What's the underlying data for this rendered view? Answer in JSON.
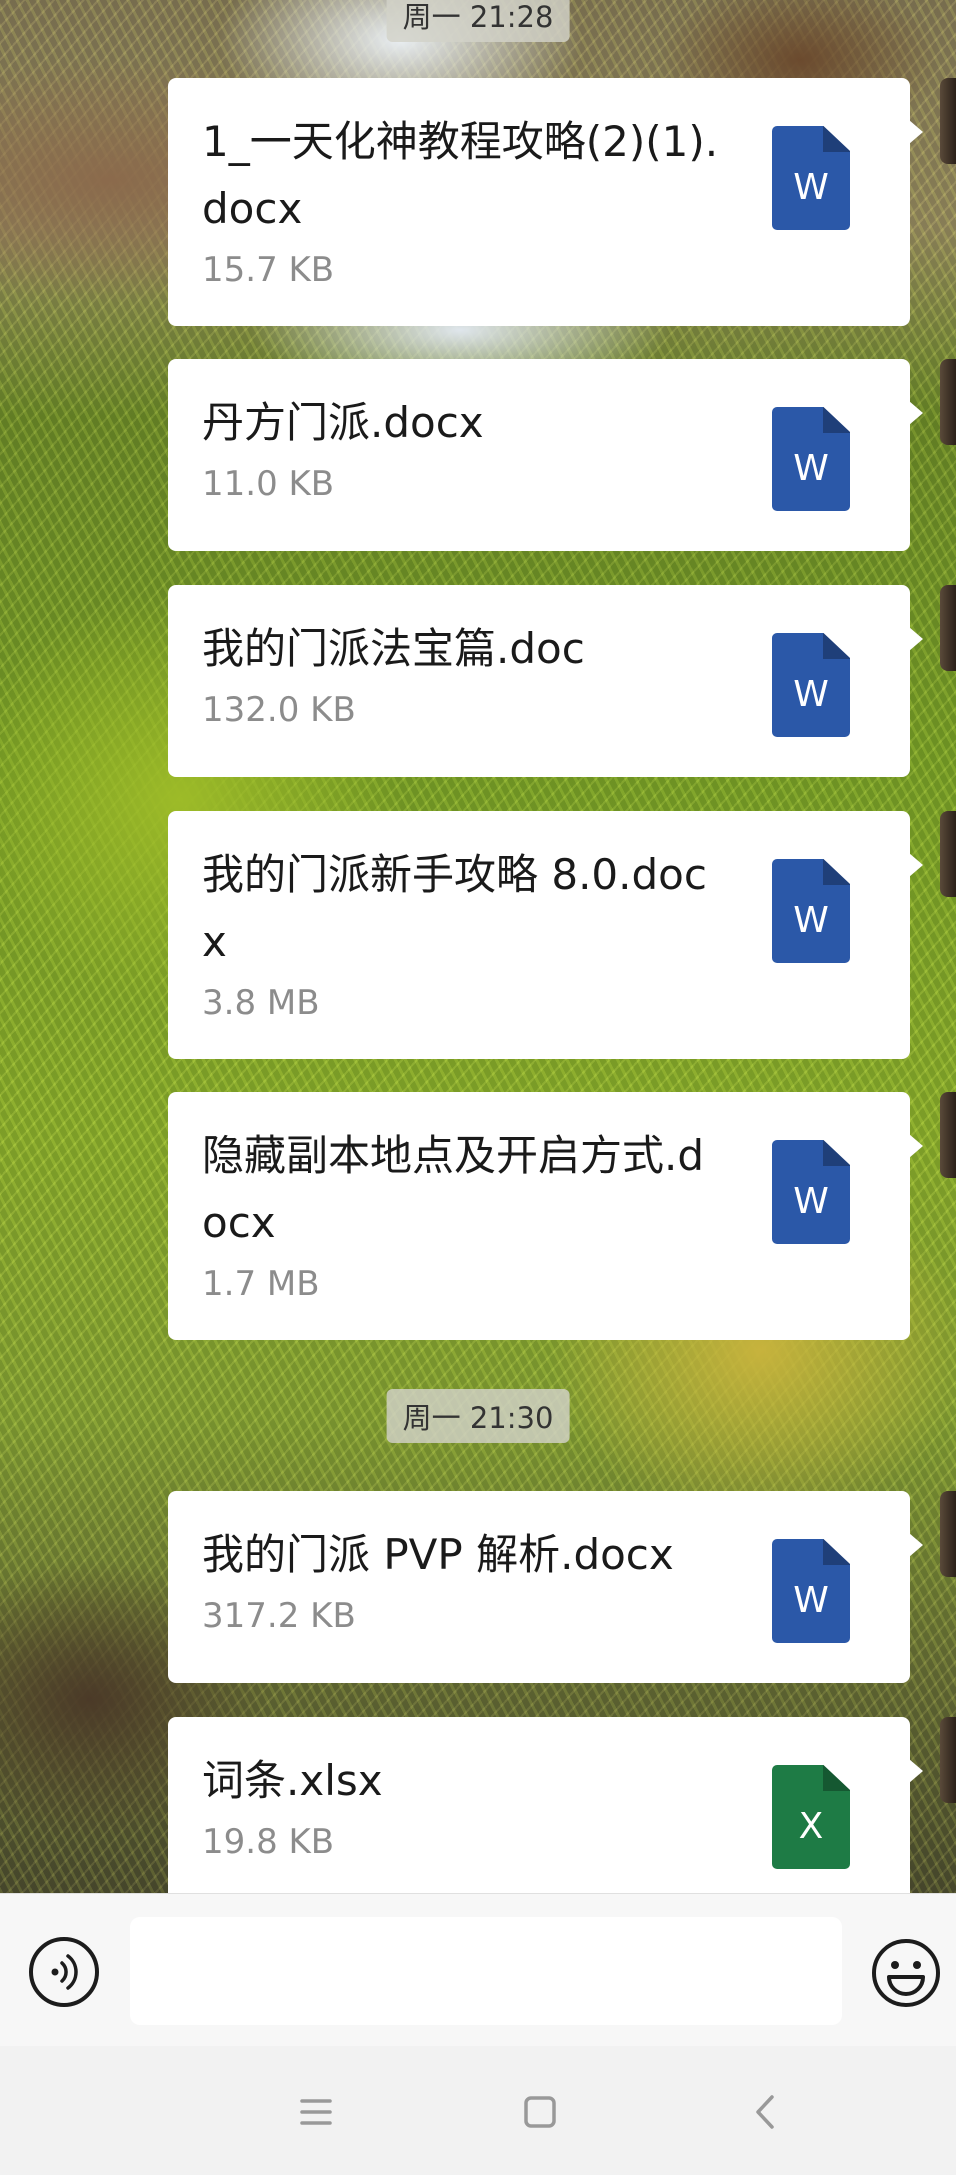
{
  "chat": {
    "timestamps": {
      "top": "周一 21:28",
      "middle": "周一 21:30"
    },
    "files": [
      {
        "name": "1_一天化神教程攻略(2)(1).docx",
        "size": "15.7 KB",
        "type_letter": "W",
        "icon": "word-doc-icon"
      },
      {
        "name": "丹方门派.docx",
        "size": "11.0 KB",
        "type_letter": "W",
        "icon": "word-doc-icon"
      },
      {
        "name": "我的门派法宝篇.doc",
        "size": "132.0 KB",
        "type_letter": "W",
        "icon": "word-doc-icon"
      },
      {
        "name": "我的门派新手攻略 8.0.docx",
        "size": "3.8 MB",
        "type_letter": "W",
        "icon": "word-doc-icon"
      },
      {
        "name": "隐藏副本地点及开启方式.docx",
        "size": "1.7 MB",
        "type_letter": "W",
        "icon": "word-doc-icon"
      },
      {
        "name": "我的门派 PVP 解析.docx",
        "size": "317.2 KB",
        "type_letter": "W",
        "icon": "word-doc-icon"
      },
      {
        "name": "词条.xlsx",
        "size": "19.8 KB",
        "type_letter": "X",
        "icon": "excel-sheet-icon"
      }
    ]
  },
  "input_bar": {
    "voice_icon": "voice-input-icon",
    "text_value": "",
    "emoji_icon": "emoji-icon"
  },
  "nav_bar": {
    "menu_icon": "menu-icon",
    "home_icon": "home-icon",
    "back_icon": "back-icon"
  },
  "colors": {
    "word": "#2b58a8",
    "excel": "#1e7b45",
    "bubble": "#ffffff"
  }
}
